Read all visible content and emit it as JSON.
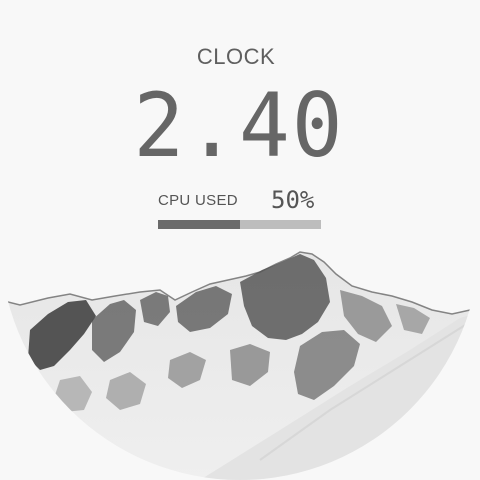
{
  "title": "CLOCK",
  "time": "2.40",
  "cpu": {
    "label": "CPU USED",
    "value_text": "50%",
    "fraction": 0.5
  },
  "colors": {
    "background": "#f8f8f8",
    "text": "#5f5f5f",
    "bar_fill": "#6b6b6b",
    "bar_track": "#bdbdbd"
  },
  "image": {
    "icon": "snowy-mountain-landscape"
  }
}
